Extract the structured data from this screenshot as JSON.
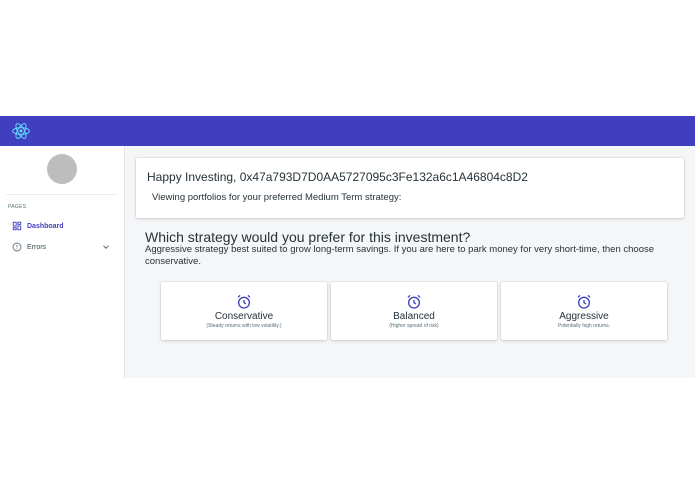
{
  "topbar": {
    "logo_icon": "react-atom-icon",
    "color": "#3f3fbf"
  },
  "sidebar": {
    "section_label": "PAGES",
    "items": [
      {
        "label": "Dashboard",
        "icon": "dashboard-grid-icon",
        "active": true
      },
      {
        "label": "Errors",
        "icon": "error-outline-icon",
        "expandable": true
      }
    ]
  },
  "welcome": {
    "title": "Happy Investing, 0x47a793D7D0AA5727095c3Fe132a6c1A46804c8D2",
    "subtitle": "Viewing portfolios for your preferred Medium Term strategy:"
  },
  "strategy": {
    "question": "Which strategy would you prefer for this investment?",
    "advice": "Aggressive strategy best suited to grow long-term savings. If you are here to park money for very short-time, then choose conservative.",
    "options": [
      {
        "name": "Conservative",
        "description": "(Steady returns with low volatility.)",
        "icon": "alarm-clock-icon"
      },
      {
        "name": "Balanced",
        "description": "(Higher spread of risk)",
        "icon": "alarm-clock-icon"
      },
      {
        "name": "Aggressive",
        "description": "Potentially high returns.",
        "icon": "alarm-clock-icon"
      }
    ]
  }
}
